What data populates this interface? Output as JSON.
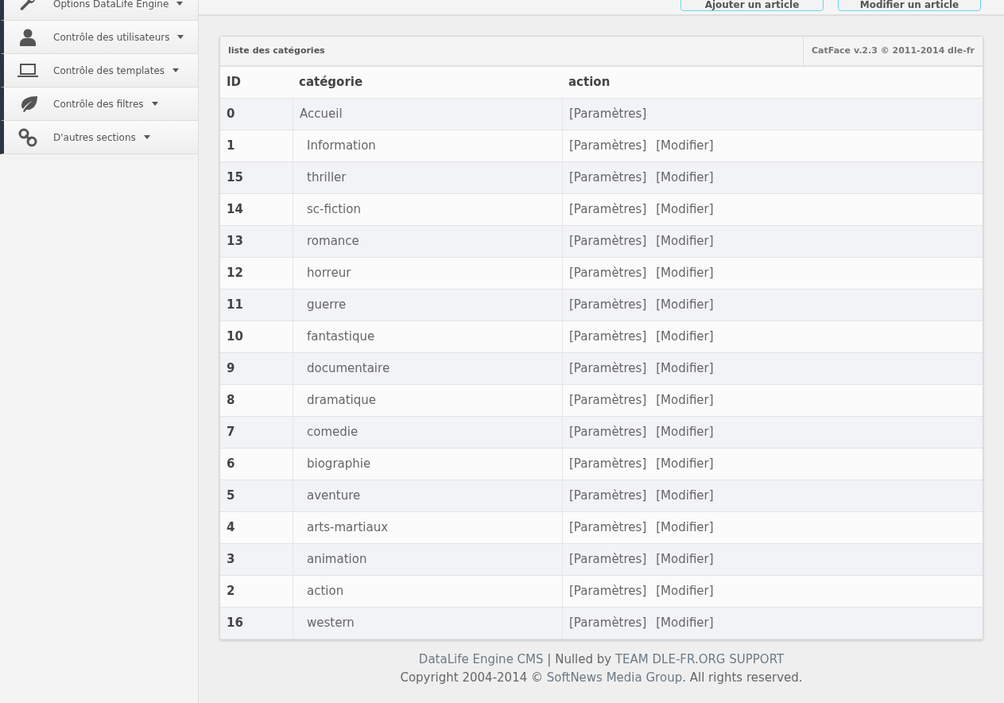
{
  "sidebar": {
    "items": [
      {
        "kind": "wrench",
        "label": "Options DataLife Engine"
      },
      {
        "kind": "user",
        "label": "Contrôle des utilisateurs"
      },
      {
        "kind": "laptop",
        "label": "Contrôle des templates"
      },
      {
        "kind": "leaf",
        "label": "Contrôle des filtres"
      },
      {
        "kind": "link",
        "label": "D'autres sections"
      }
    ]
  },
  "top_buttons": [
    "Ajouter un article",
    "Modifier un article"
  ],
  "panel": {
    "title": "liste des catégories",
    "version": "CatFace v.2.3 © 2011-2014 dle-fr",
    "table": {
      "columns": [
        "ID",
        "catégorie",
        "action"
      ],
      "rows": [
        {
          "id": "0",
          "name": "Accueil",
          "actions": [
            "[Paramètres]"
          ],
          "children": [
            {
              "id": "1",
              "name": "Information",
              "actions": [
                "[Paramètres]",
                "[Modifier]"
              ]
            },
            {
              "id": "15",
              "name": "thriller",
              "actions": [
                "[Paramètres]",
                "[Modifier]"
              ]
            },
            {
              "id": "14",
              "name": "sc-fiction",
              "actions": [
                "[Paramètres]",
                "[Modifier]"
              ]
            },
            {
              "id": "13",
              "name": "romance",
              "actions": [
                "[Paramètres]",
                "[Modifier]"
              ]
            },
            {
              "id": "12",
              "name": "horreur",
              "actions": [
                "[Paramètres]",
                "[Modifier]"
              ]
            },
            {
              "id": "11",
              "name": "guerre",
              "actions": [
                "[Paramètres]",
                "[Modifier]"
              ]
            },
            {
              "id": "10",
              "name": "fantastique",
              "actions": [
                "[Paramètres]",
                "[Modifier]"
              ]
            },
            {
              "id": "9",
              "name": "documentaire",
              "actions": [
                "[Paramètres]",
                "[Modifier]"
              ]
            },
            {
              "id": "8",
              "name": "dramatique",
              "actions": [
                "[Paramètres]",
                "[Modifier]"
              ]
            },
            {
              "id": "7",
              "name": "comedie",
              "actions": [
                "[Paramètres]",
                "[Modifier]"
              ]
            },
            {
              "id": "6",
              "name": "biographie",
              "actions": [
                "[Paramètres]",
                "[Modifier]"
              ]
            },
            {
              "id": "5",
              "name": "aventure",
              "actions": [
                "[Paramètres]",
                "[Modifier]"
              ]
            },
            {
              "id": "4",
              "name": "arts-martiaux",
              "actions": [
                "[Paramètres]",
                "[Modifier]"
              ]
            },
            {
              "id": "3",
              "name": "animation",
              "actions": [
                "[Paramètres]",
                "[Modifier]"
              ]
            },
            {
              "id": "2",
              "name": "action",
              "actions": [
                "[Paramètres]",
                "[Modifier]"
              ]
            },
            {
              "id": "16",
              "name": "western",
              "actions": [
                "[Paramètres]",
                "[Modifier]"
              ]
            }
          ]
        }
      ]
    }
  },
  "footer": {
    "lines": [
      [
        {
          "kind": "link",
          "text": "DataLife Engine CMS"
        },
        {
          "kind": "text",
          "text": "|"
        },
        {
          "kind": "text",
          "text": "Nulled by"
        },
        {
          "kind": "link",
          "text": "TEAM DLE-FR.ORG SUPPORT"
        }
      ],
      [
        {
          "kind": "text",
          "text": "Copyright 2004-2014 ©"
        },
        {
          "kind": "link",
          "text": "SoftNews Media Group"
        },
        {
          "kind": "text",
          "text": ". All rights reserved."
        }
      ]
    ]
  }
}
